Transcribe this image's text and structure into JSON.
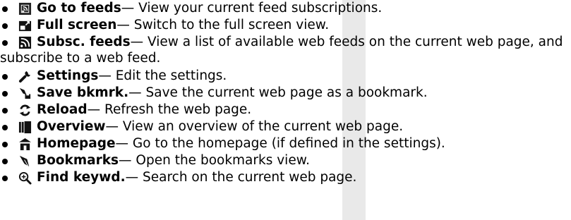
{
  "items": [
    {
      "icon": "go-to-feeds-icon",
      "label": "Go to feeds",
      "desc": " — View your current feed subscriptions."
    },
    {
      "icon": "full-screen-icon",
      "label": "Full screen",
      "desc": " — Switch to the full screen view."
    },
    {
      "icon": "subscribe-feeds-icon",
      "label": "Subsc. feeds",
      "desc": " — View a list of available web feeds on the current web page, and",
      "desc2": "subscribe to a web feed."
    },
    {
      "icon": "settings-wrench-icon",
      "label": "Settings",
      "desc": " — Edit the settings."
    },
    {
      "icon": "save-bookmark-icon",
      "label": "Save bkmrk.",
      "desc": " — Save the current web page as a bookmark."
    },
    {
      "icon": "reload-icon",
      "label": "Reload",
      "desc": " — Refresh the web page."
    },
    {
      "icon": "overview-icon",
      "label": "Overview",
      "desc": " — View an overview of the current web page."
    },
    {
      "icon": "homepage-icon",
      "label": "Homepage",
      "desc": " — Go to the homepage (if defined in the settings)."
    },
    {
      "icon": "bookmarks-icon",
      "label": "Bookmarks",
      "desc": " — Open the bookmarks view."
    },
    {
      "icon": "find-keyword-icon",
      "label": "Find keywd.",
      "desc": " — Search on the current web page."
    }
  ]
}
